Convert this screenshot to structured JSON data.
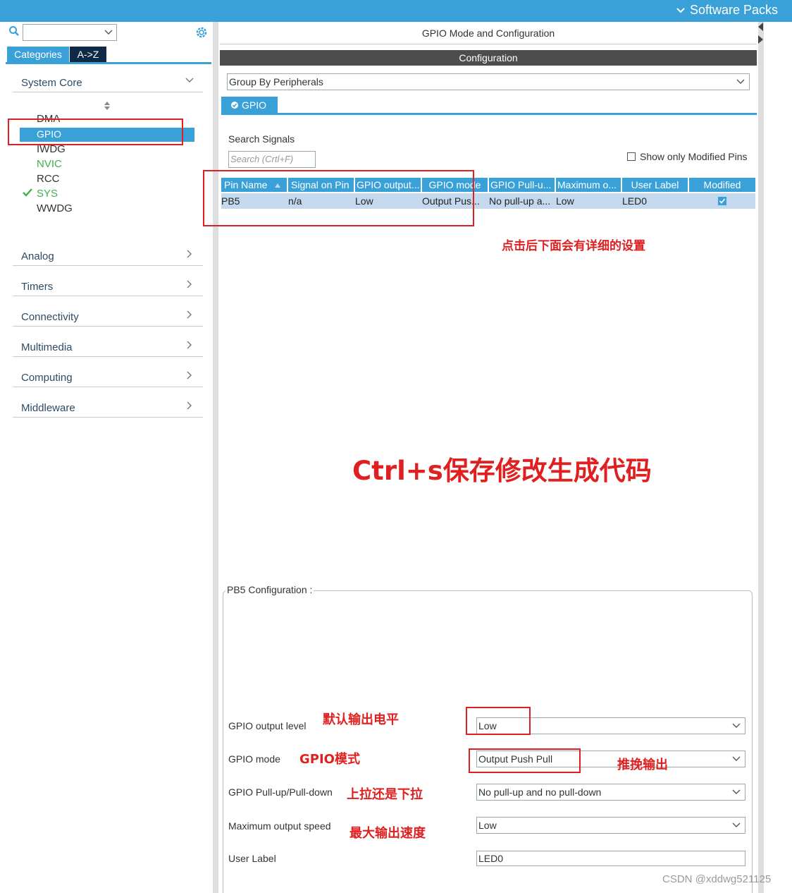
{
  "topbar": {
    "software_packs": "Software Packs"
  },
  "left": {
    "tabs": {
      "categories": "Categories",
      "az": "A->Z"
    },
    "categories": [
      {
        "label": "System Core"
      },
      {
        "label": "Analog"
      },
      {
        "label": "Timers"
      },
      {
        "label": "Connectivity"
      },
      {
        "label": "Multimedia"
      },
      {
        "label": "Computing"
      },
      {
        "label": "Middleware"
      }
    ],
    "system_core_items": [
      "DMA",
      "GPIO",
      "IWDG",
      "NVIC",
      "RCC",
      "SYS",
      "WWDG"
    ]
  },
  "right": {
    "mode_title": "GPIO Mode and Configuration",
    "config_bar": "Configuration",
    "group_by": "Group By Peripherals",
    "gpio_tab": "GPIO",
    "search_signals_label": "Search Signals",
    "search_placeholder": "Search (Crtl+F)",
    "show_modified": "Show only Modified Pins",
    "table": {
      "headers": [
        "Pin Name",
        "Signal on Pin",
        "GPIO output...",
        "GPIO mode",
        "GPIO Pull-u...",
        "Maximum o...",
        "User Label",
        "Modified"
      ],
      "row": [
        "PB5",
        "n/a",
        "Low",
        "Output Pus...",
        "No pull-up a...",
        "Low",
        "LED0",
        ""
      ]
    },
    "pb5_config": {
      "title": "PB5 Configuration :",
      "fields": [
        {
          "label": "GPIO output level",
          "value": "Low"
        },
        {
          "label": "GPIO mode",
          "value": "Output Push Pull"
        },
        {
          "label": "GPIO Pull-up/Pull-down",
          "value": "No pull-up and no pull-down"
        },
        {
          "label": "Maximum output speed",
          "value": "Low"
        },
        {
          "label": "User Label",
          "value": "LED0"
        }
      ]
    }
  },
  "annotations": {
    "click_note": "点击后下面会有详细的设置",
    "save_note": "Ctrl+s保存修改生成代码",
    "output_level_note": "默认输出电平",
    "mode_note": "GPIO模式",
    "push_pull_note": "推挽输出",
    "pull_note": "上拉还是下拉",
    "speed_note": "最大输出速度"
  },
  "watermark": "CSDN @xddwg521125",
  "colors": {
    "accent": "#3aa0d8",
    "annotation": "#e02020",
    "nvic_green": "#3db24b"
  }
}
